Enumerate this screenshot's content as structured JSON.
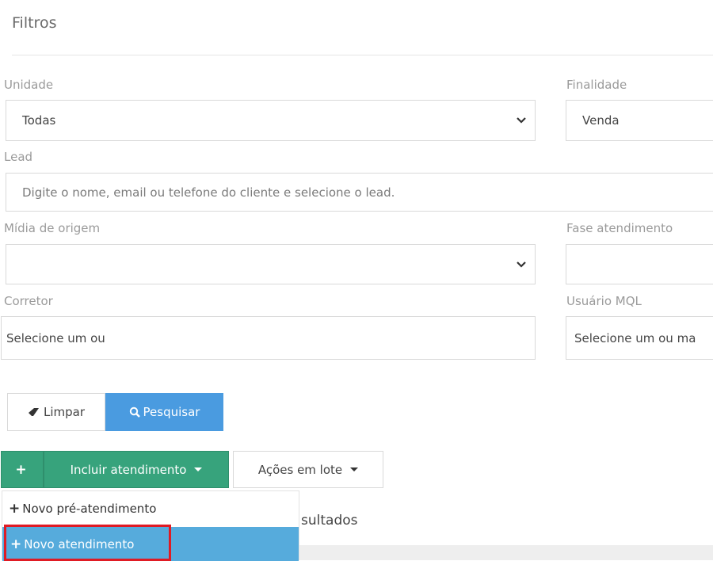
{
  "panel": {
    "title": "Filtros"
  },
  "filters": {
    "unidade": {
      "label": "Unidade",
      "value": "Todas"
    },
    "finalidade": {
      "label": "Finalidade",
      "value": "Venda"
    },
    "lead": {
      "label": "Lead",
      "placeholder": "Digite o nome, email ou telefone do cliente e selecione o lead."
    },
    "midia": {
      "label": "Mídia de origem",
      "value": ""
    },
    "fase": {
      "label": "Fase atendimento",
      "value": ""
    },
    "corretor": {
      "label": "Corretor",
      "placeholder": "Selecione um ou"
    },
    "usuario_mql": {
      "label": "Usuário MQL",
      "placeholder": "Selecione um ou ma"
    }
  },
  "buttons": {
    "limpar": "Limpar",
    "pesquisar": "Pesquisar",
    "incluir_plus": "+",
    "incluir": "Incluir atendimento",
    "acoes": "Ações em lote"
  },
  "dropdown_menu": {
    "items": [
      {
        "label": "Novo pré-atendimento"
      },
      {
        "label": "Novo atendimento"
      }
    ]
  },
  "results": {
    "text": "sultados"
  },
  "icons": {
    "chevron": "chevron-down-icon",
    "eraser": "eraser-icon",
    "search": "search-icon",
    "plus": "plus-icon",
    "caret": "caret-down-icon"
  },
  "colors": {
    "primary_blue": "#4a9be0",
    "success_green": "#37a37c",
    "menu_active": "#56abdc",
    "highlight_red": "#e01b24"
  }
}
